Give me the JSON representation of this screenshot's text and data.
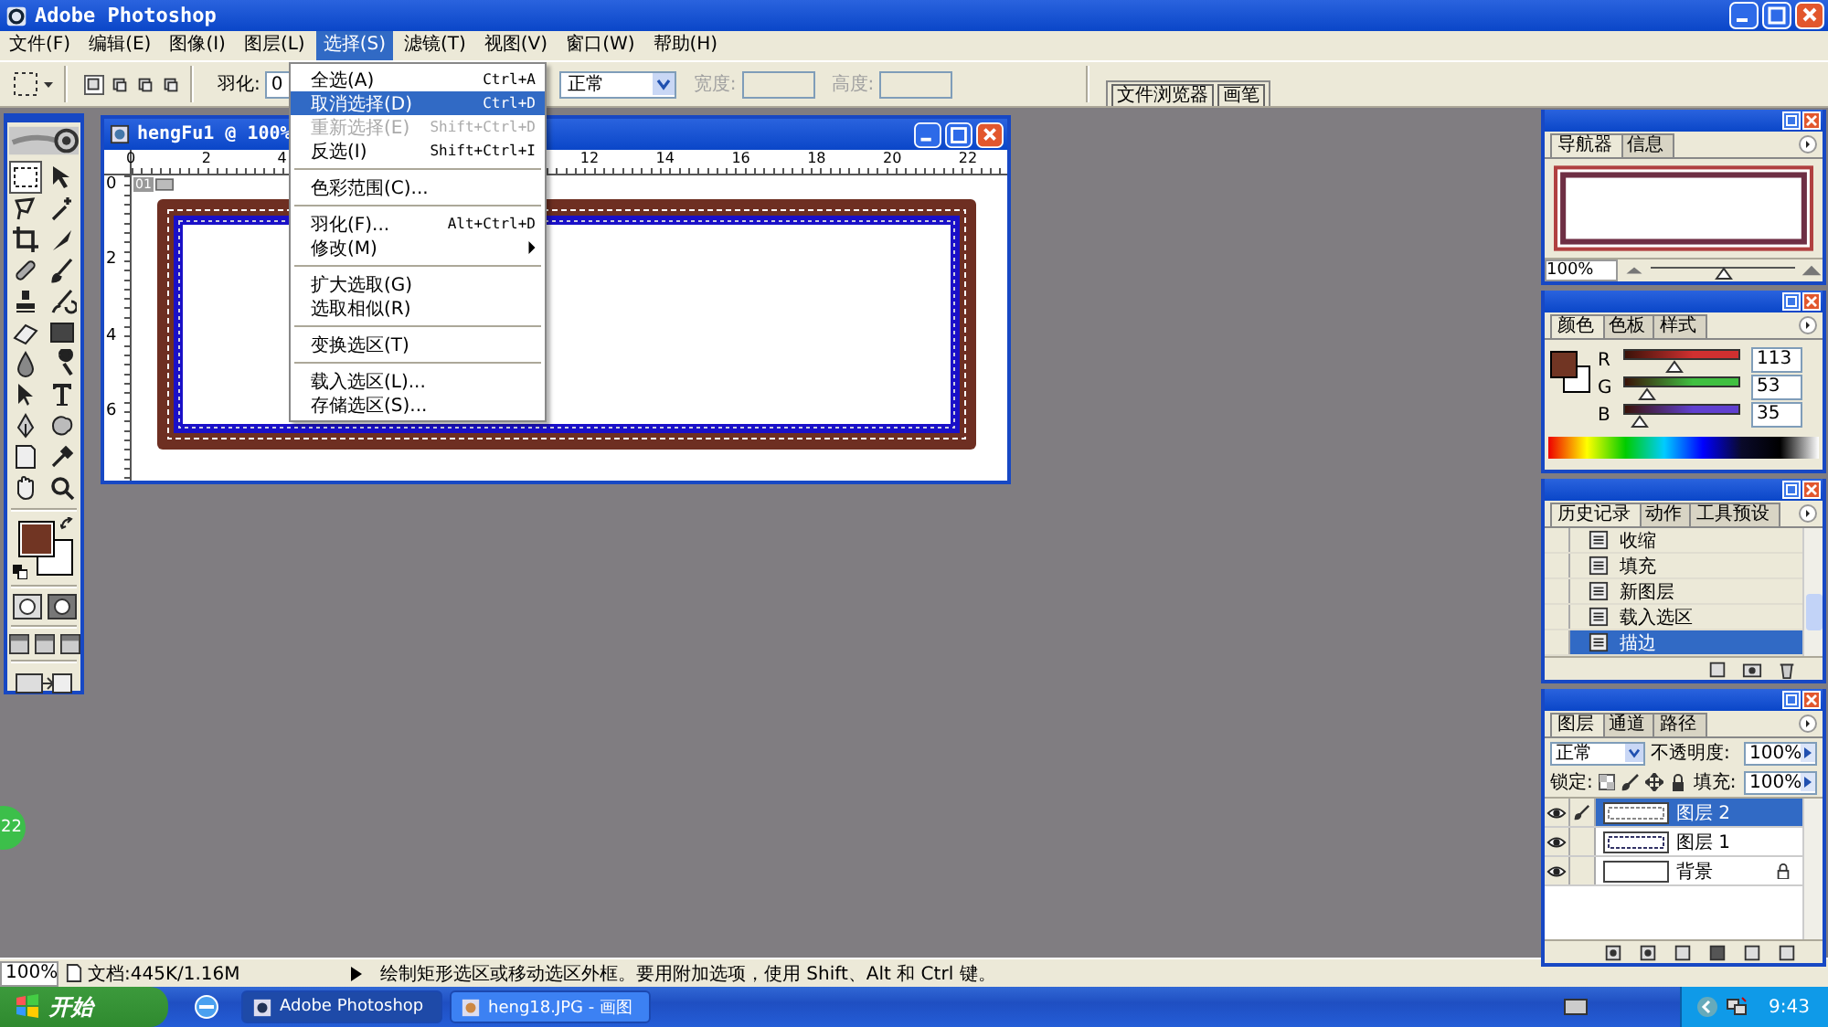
{
  "window": {
    "title": "Adobe Photoshop"
  },
  "menus": [
    {
      "label": "文件(F)",
      "selected": false
    },
    {
      "label": "编辑(E)",
      "selected": false
    },
    {
      "label": "图像(I)",
      "selected": false
    },
    {
      "label": "图层(L)",
      "selected": false
    },
    {
      "label": "选择(S)",
      "selected": true
    },
    {
      "label": "滤镜(T)",
      "selected": false
    },
    {
      "label": "视图(V)",
      "selected": false
    },
    {
      "label": "窗口(W)",
      "selected": false
    },
    {
      "label": "帮助(H)",
      "selected": false
    }
  ],
  "options": {
    "modes": [
      {
        "selected": true
      },
      {
        "selected": false
      },
      {
        "selected": false
      },
      {
        "selected": false
      }
    ],
    "feather_label": "羽化:",
    "feather_value": "0",
    "style_value": "正常",
    "width_label": "宽度:",
    "height_label": "高度:",
    "palette_tabs": [
      "文件浏览器",
      "画笔"
    ]
  },
  "dropdown": [
    {
      "kind": "item",
      "label": "全选(A)",
      "shortcut": "Ctrl+A",
      "selected": false,
      "disabled": false
    },
    {
      "kind": "item",
      "label": "取消选择(D)",
      "shortcut": "Ctrl+D",
      "selected": true,
      "disabled": false
    },
    {
      "kind": "item",
      "label": "重新选择(E)",
      "shortcut": "Shift+Ctrl+D",
      "selected": false,
      "disabled": true
    },
    {
      "kind": "item",
      "label": "反选(I)",
      "shortcut": "Shift+Ctrl+I",
      "selected": false,
      "disabled": false
    },
    {
      "kind": "separator"
    },
    {
      "kind": "item",
      "label": "色彩范围(C)...",
      "selected": false,
      "disabled": false
    },
    {
      "kind": "separator"
    },
    {
      "kind": "item",
      "label": "羽化(F)...",
      "shortcut": "Alt+Ctrl+D",
      "selected": false,
      "disabled": false
    },
    {
      "kind": "submenu",
      "label": "修改(M)",
      "selected": false,
      "disabled": false
    },
    {
      "kind": "separator"
    },
    {
      "kind": "item",
      "label": "扩大选取(G)",
      "selected": false,
      "disabled": false
    },
    {
      "kind": "item",
      "label": "选取相似(R)",
      "selected": false,
      "disabled": false
    },
    {
      "kind": "separator"
    },
    {
      "kind": "item",
      "label": "变换选区(T)",
      "selected": false,
      "disabled": false
    },
    {
      "kind": "separator"
    },
    {
      "kind": "item",
      "label": "载入选区(L)...",
      "selected": false,
      "disabled": false
    },
    {
      "kind": "item",
      "label": "存储选区(S)...",
      "selected": false,
      "disabled": false
    }
  ],
  "document": {
    "title": "hengFu1 @ 100%",
    "top_ruler": [
      "0",
      "2",
      "4",
      "12",
      "14",
      "16",
      "18",
      "20",
      "22"
    ],
    "left_ruler": [
      "0",
      "2",
      "4",
      "6"
    ],
    "slice_label": "01"
  },
  "navigator": {
    "tabs": [
      {
        "label": "导航器",
        "selected": true
      },
      {
        "label": "信息",
        "selected": false
      }
    ],
    "zoom": "100%",
    "level": 0.5
  },
  "color": {
    "tabs": [
      {
        "label": "颜色",
        "selected": true
      },
      {
        "label": "色板",
        "selected": false
      },
      {
        "label": "样式",
        "selected": false
      }
    ],
    "channels": [
      {
        "name": "R",
        "value": "113",
        "level": 0.443,
        "color": "#d03030"
      },
      {
        "name": "G",
        "value": "53",
        "level": 0.208,
        "color": "#40c040"
      },
      {
        "name": "B",
        "value": "35",
        "level": 0.137,
        "color": "#6040d0"
      }
    ]
  },
  "history": {
    "tabs": [
      {
        "label": "历史记录",
        "selected": true
      },
      {
        "label": "动作",
        "selected": false
      },
      {
        "label": "工具预设",
        "selected": false
      }
    ],
    "items": [
      {
        "label": "收缩",
        "selected": false
      },
      {
        "label": "填充",
        "selected": false
      },
      {
        "label": "新图层",
        "selected": false
      },
      {
        "label": "载入选区",
        "selected": false
      },
      {
        "label": "描边",
        "selected": true
      }
    ]
  },
  "layers": {
    "tabs": [
      {
        "label": "图层",
        "selected": true
      },
      {
        "label": "通道",
        "selected": false
      },
      {
        "label": "路径",
        "selected": false
      }
    ],
    "blend": "正常",
    "opacity_label": "不透明度:",
    "opacity": "100%",
    "lock_label": "锁定:",
    "fill_label": "填充:",
    "fill": "100%",
    "items": [
      {
        "name": "图层 2",
        "visible": true,
        "selected": true,
        "locked": false
      },
      {
        "name": "图层 1",
        "visible": true,
        "selected": false,
        "locked": false
      },
      {
        "name": "背景",
        "visible": true,
        "selected": false,
        "locked": true
      }
    ]
  },
  "side_badge": "22",
  "status_bar": {
    "zoom": "100%",
    "doc": "文档:445K/1.16M",
    "hint": "绘制矩形选区或移动选区外框。要用附加选项，使用 Shift、Alt 和 Ctrl 键。"
  },
  "taskbar": {
    "start": "开始",
    "tasks": [
      {
        "label": "Adobe Photoshop",
        "selected": true
      },
      {
        "label": "heng18.JPG - 画图",
        "selected": false
      }
    ],
    "clock": "9:43"
  }
}
